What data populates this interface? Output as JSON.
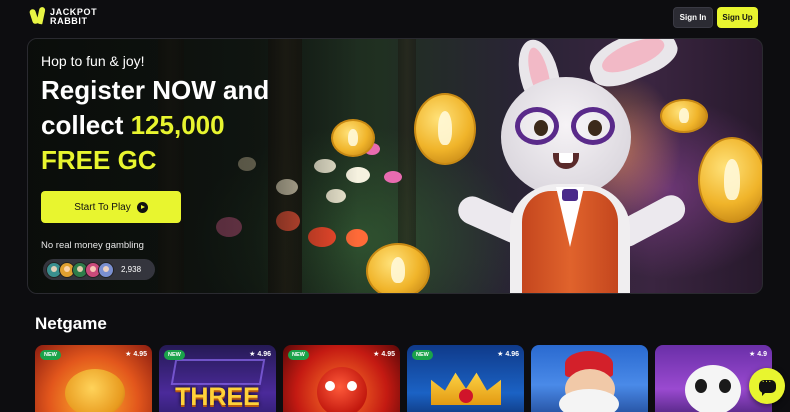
{
  "header": {
    "logo_line1": "JACKPOT",
    "logo_line2": "RABBIT",
    "signin_label": "Sign In",
    "signup_label": "Sign Up"
  },
  "hero": {
    "tagline": "Hop to fun & joy!",
    "title_line1": "Register NOW and",
    "title_line2_prefix": "collect ",
    "title_highlight_amount": "125,000",
    "title_highlight_line3": "FREE GC",
    "cta_label": "Start To Play",
    "disclaimer": "No real money gambling",
    "player_count": "2,938"
  },
  "section": {
    "title": "Netgame"
  },
  "games": [
    {
      "badge": "NEW",
      "rating": "4.95",
      "word": ""
    },
    {
      "badge": "NEW",
      "rating": "4.96",
      "word": "THREE"
    },
    {
      "badge": "NEW",
      "rating": "4.95",
      "word": ""
    },
    {
      "badge": "NEW",
      "rating": "4.96",
      "word": ""
    },
    {
      "badge": "",
      "rating": "",
      "word": ""
    },
    {
      "badge": "",
      "rating": "4.9",
      "word": ""
    }
  ],
  "colors": {
    "accent": "#e8f52f",
    "badge_new": "#1aa34a",
    "background": "#0d0d10"
  },
  "icons": {
    "star": "star-icon",
    "play": "play-icon",
    "chat": "chat-icon"
  }
}
